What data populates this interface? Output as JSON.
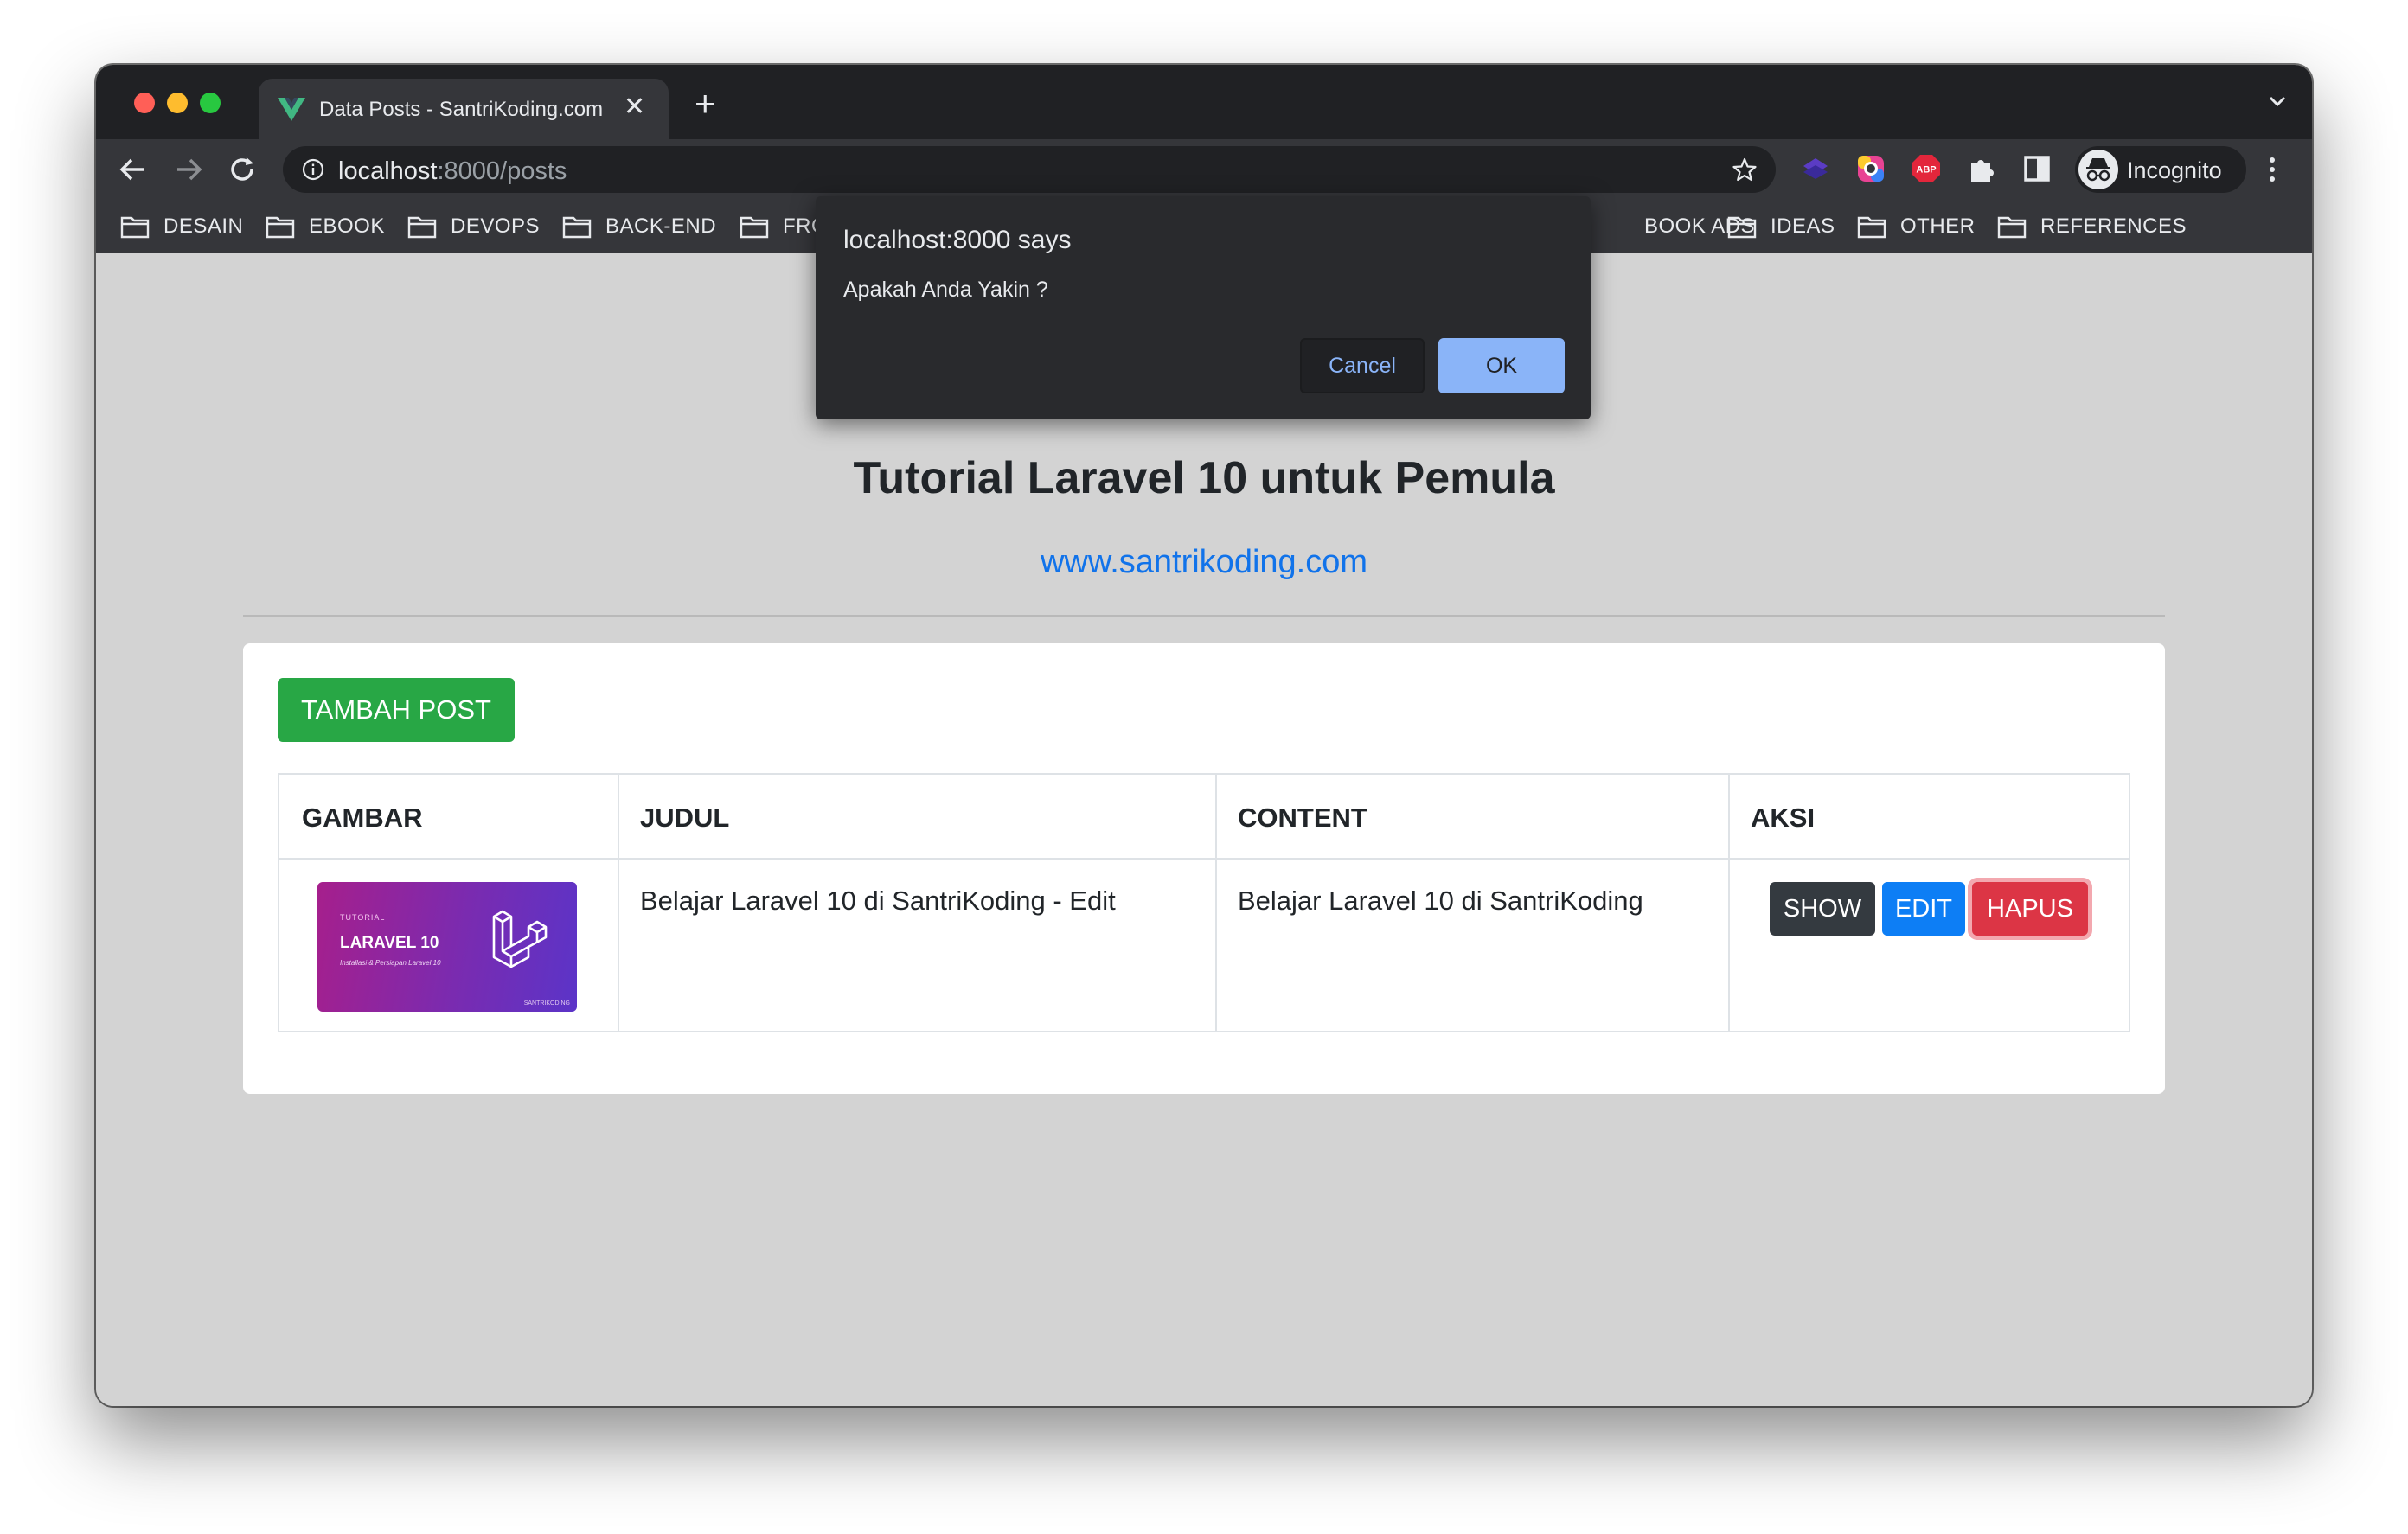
{
  "browser": {
    "tab_title": "Data Posts - SantriKoding.com",
    "url_host": "localhost",
    "url_rest": ":8000/posts",
    "profile_label": "Incognito",
    "extensions": [
      "abp-icon"
    ],
    "abp_label": "ABP",
    "bookmarks": [
      {
        "label": "DESAIN"
      },
      {
        "label": "EBOOK"
      },
      {
        "label": "DEVOPS"
      },
      {
        "label": "BACK-END"
      },
      {
        "label": "FRO"
      },
      {
        "label": "BOOK ADS"
      },
      {
        "label": "IDEAS"
      },
      {
        "label": "OTHER"
      },
      {
        "label": "REFERENCES"
      }
    ]
  },
  "dialog": {
    "title": "localhost:8000 says",
    "message": "Apakah Anda Yakin ?",
    "cancel_label": "Cancel",
    "ok_label": "OK"
  },
  "page": {
    "title": "Tutorial Laravel 10 untuk Pemula",
    "link": "www.santrikoding.com",
    "add_button": "TAMBAH POST",
    "table": {
      "headers": [
        "GAMBAR",
        "JUDUL",
        "CONTENT",
        "AKSI"
      ],
      "rows": [
        {
          "image": {
            "small": "TUTORIAL",
            "big": "LARAVEL 10",
            "sub": "Installasi & Persiapan Laravel 10",
            "mark": "SANTRIKODING"
          },
          "judul": "Belajar Laravel 10 di SantriKoding - Edit",
          "content": "Belajar Laravel 10 di SantriKoding",
          "actions": [
            "SHOW",
            "EDIT",
            "HAPUS"
          ]
        }
      ]
    }
  },
  "colors": {
    "page_bg": "#d3d3d3",
    "link": "#1173ea",
    "success": "#28a745",
    "primary": "#0d7ef5",
    "danger": "#dc3545",
    "dark": "#343a40",
    "dialog_bg": "#292a2d",
    "dialog_ok": "#8ab4f8"
  }
}
